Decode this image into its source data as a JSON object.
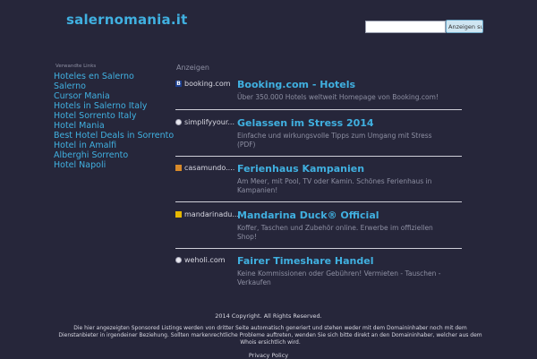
{
  "header": {
    "site_title": "salernomania.it",
    "search_placeholder": "",
    "search_button": "Anzeigen suchen"
  },
  "related": {
    "heading": "Verwandte Links",
    "links": [
      "Hoteles en Salerno",
      "Salerno",
      "Cursor Mania",
      "Hotels in Salerno Italy",
      "Hotel Sorrento Italy",
      "Hotel Mania",
      "Best Hotel Deals in Sorrento",
      "Hotel in Amalfi",
      "Alberghi Sorrento",
      "Hotel Napoli"
    ]
  },
  "ads": {
    "label": "Anzeigen",
    "items": [
      {
        "icon": "booking-b-icon",
        "source": "booking.com",
        "title": "Booking.com - Hotels",
        "description": "Über 350.000 Hotels weltweit Homepage von Booking.com!"
      },
      {
        "icon": "globe-icon",
        "source": "simplifyyour...",
        "title": "Gelassen im Stress 2014",
        "description": "Einfache und wirkungsvolle Tipps zum Umgang mit Stress (PDF)"
      },
      {
        "icon": "house-icon",
        "source": "casamundo....",
        "title": "Ferienhaus Kampanien",
        "description": "Am Meer, mit Pool, TV oder Kamin. Schönes Ferienhaus in Kampanien!"
      },
      {
        "icon": "mandarina-icon",
        "source": "mandarinadu...",
        "title": "Mandarina Duck® Official",
        "description": "Koffer, Taschen und Zubehör online. Erwerbe im offiziellen Shop!"
      },
      {
        "icon": "globe-icon",
        "source": "weholi.com",
        "title": "Fairer Timeshare Handel",
        "description": "Keine Kommissionen oder Gebühren! Vermieten - Tauschen - Verkaufen"
      }
    ]
  },
  "footer": {
    "copyright": "2014 Copyright. All Rights Reserved.",
    "disclaimer": "Die hier angezeigten Sponsored Listings werden von dritter Seite automatisch generiert und stehen weder mit dem Domaininhaber noch mit dem Dienstanbieter in irgendeiner Beziehung. Sollten markenrechtliche Probleme auftreten, wenden Sie sich bitte direkt an den Domaininhaber, welcher aus dem Whois ersichtlich wird.",
    "privacy": "Privacy Policy"
  },
  "colors": {
    "background": "#26263a",
    "link": "#40b0e0",
    "muted_text": "#8d8fa2"
  }
}
